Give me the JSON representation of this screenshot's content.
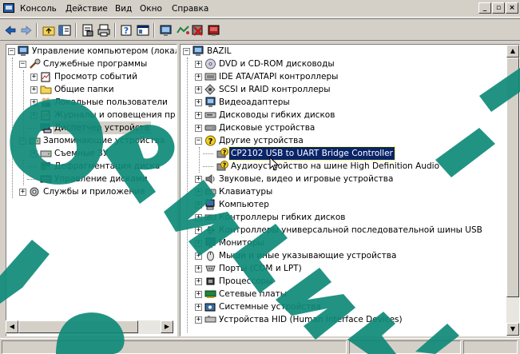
{
  "menu": {
    "items": [
      "Консоль",
      "Действие",
      "Вид",
      "Окно",
      "Справка"
    ],
    "window_buttons": [
      "_",
      "▫",
      "×"
    ]
  },
  "toolbar": {
    "icons": [
      "back-arrow-icon",
      "forward-arrow-icon",
      "up-folder-icon",
      "show-tree-icon",
      "properties-icon",
      "print-icon",
      "help-icon",
      "console-tree-icon",
      "scan-hardware-icon",
      "update-driver-icon",
      "disable-device-icon",
      "uninstall-device-icon"
    ]
  },
  "left_tree": [
    {
      "label": "Управление компьютером (локалі",
      "level": 0,
      "expander": "−"
    },
    {
      "label": "Служебные программы",
      "level": 1,
      "expander": "−"
    },
    {
      "label": "Просмотр событий",
      "level": 2,
      "expander": "+"
    },
    {
      "label": "Общие папки",
      "level": 2,
      "expander": "+"
    },
    {
      "label": "Локальные пользователи",
      "level": 2,
      "expander": "+"
    },
    {
      "label": "Журналы и оповещения пр",
      "level": 2,
      "expander": "+"
    },
    {
      "label": "Диспетчер устройств",
      "level": 2,
      "expander": "",
      "selected": true
    },
    {
      "label": "Запоминающие устройства",
      "level": 1,
      "expander": "−"
    },
    {
      "label": "Съемные ЗУ",
      "level": 2,
      "expander": "+"
    },
    {
      "label": "Дефрагментация диска",
      "level": 2,
      "expander": ""
    },
    {
      "label": "Управление дисками",
      "level": 2,
      "expander": ""
    },
    {
      "label": "Службы и приложения",
      "level": 1,
      "expander": "+"
    }
  ],
  "right_tree": [
    {
      "label": "BAZIL",
      "level": 0,
      "expander": "−"
    },
    {
      "label": "DVD и CD-ROM дисководы",
      "level": 1,
      "expander": "+"
    },
    {
      "label": "IDE ATA/ATAPI контроллеры",
      "level": 1,
      "expander": "+"
    },
    {
      "label": "SCSI и RAID контроллеры",
      "level": 1,
      "expander": "+"
    },
    {
      "label": "Видеоадаптеры",
      "level": 1,
      "expander": "+"
    },
    {
      "label": "Дисководы гибких дисков",
      "level": 1,
      "expander": "+"
    },
    {
      "label": "Дисковые устройства",
      "level": 1,
      "expander": "+"
    },
    {
      "label": "Другие устройства",
      "level": 1,
      "expander": "−"
    },
    {
      "label": "CP2102 USB to UART Bridge Controller",
      "level": 2,
      "expander": "",
      "selected": true
    },
    {
      "label": "Аудиоустройство на шине High Definition Audio",
      "level": 2,
      "expander": ""
    },
    {
      "label": "Звуковые, видео и игровые устройства",
      "level": 1,
      "expander": "+"
    },
    {
      "label": "Клавиатуры",
      "level": 1,
      "expander": "+"
    },
    {
      "label": "Компьютер",
      "level": 1,
      "expander": "+"
    },
    {
      "label": "Контроллеры гибких дисков",
      "level": 1,
      "expander": "+"
    },
    {
      "label": "Контроллеры универсальной последовательной шины USB",
      "level": 1,
      "expander": "+"
    },
    {
      "label": "Мониторы",
      "level": 1,
      "expander": "+"
    },
    {
      "label": "Мыши и иные указывающие устройства",
      "level": 1,
      "expander": "+"
    },
    {
      "label": "Порты (COM и LPT)",
      "level": 1,
      "expander": "+"
    },
    {
      "label": "Процессоры",
      "level": 1,
      "expander": "+"
    },
    {
      "label": "Сетевые платы",
      "level": 1,
      "expander": "+"
    },
    {
      "label": "Системные устройства",
      "level": 1,
      "expander": "+"
    },
    {
      "label": "Устройства HID (Human Interface Devices)",
      "level": 1,
      "expander": "+"
    }
  ],
  "colors": {
    "selection": "#0a246a",
    "watermark": "#0f8a78",
    "chrome": "#d4d0c8"
  }
}
